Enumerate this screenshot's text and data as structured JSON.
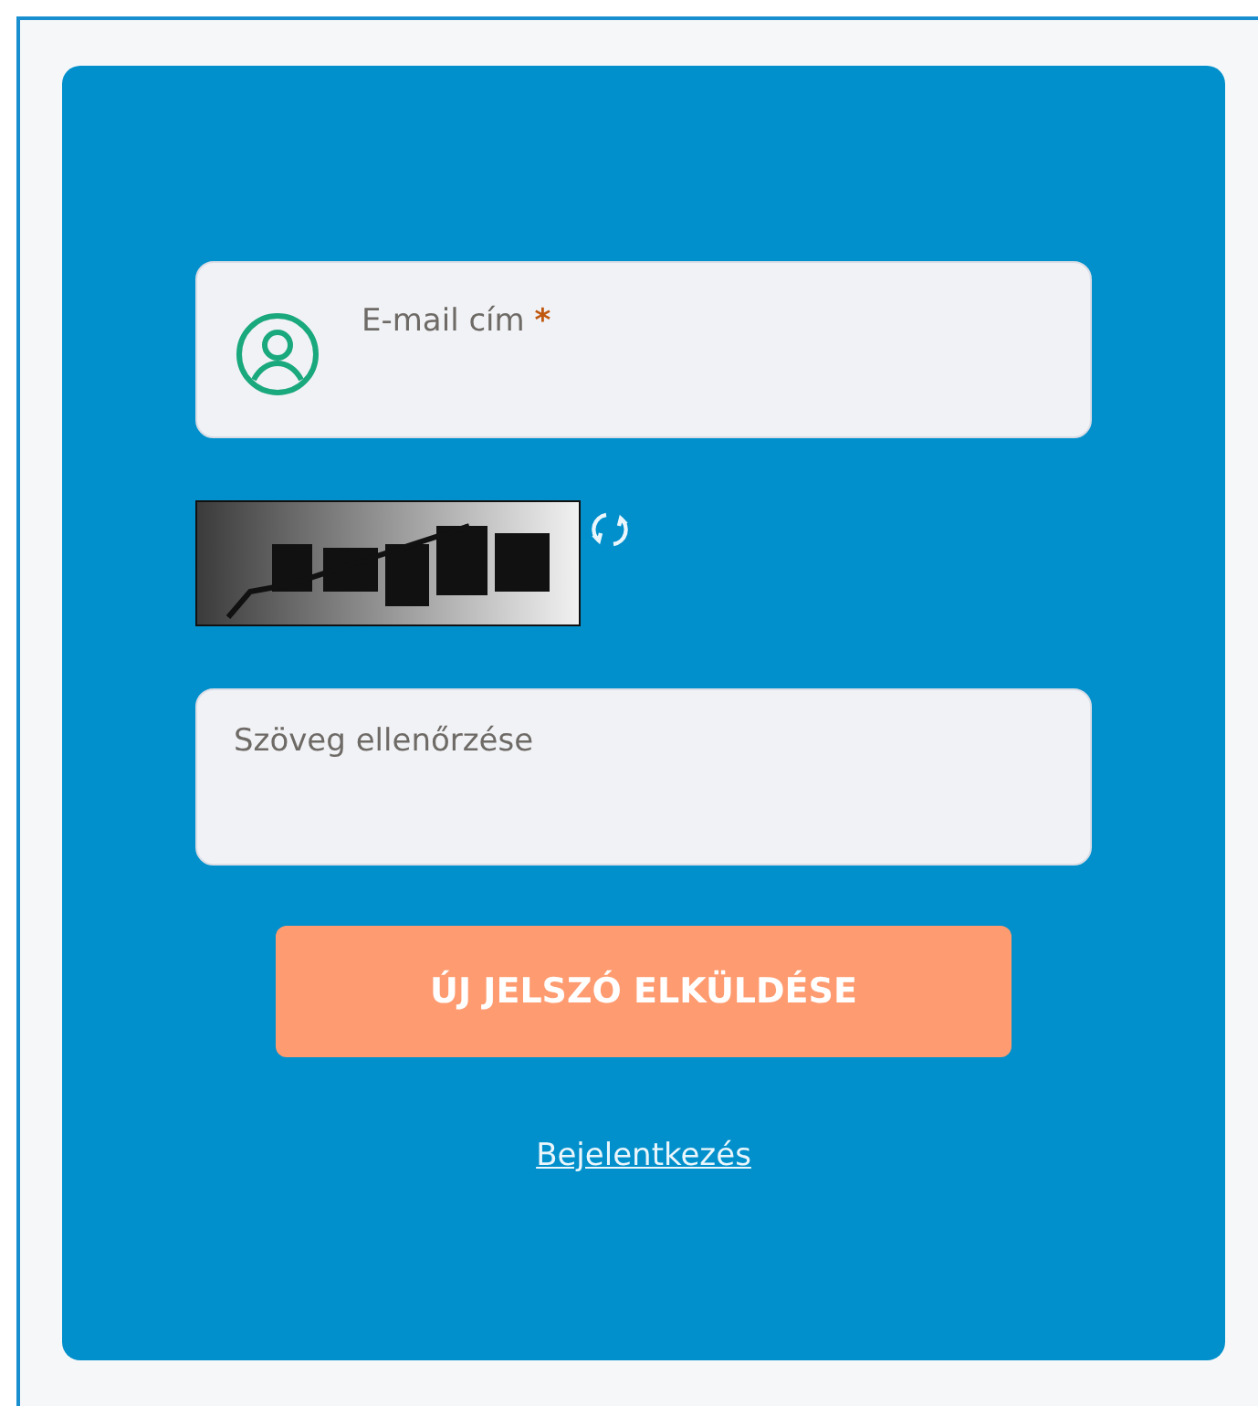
{
  "email_field": {
    "label": "E-mail cím",
    "required_mark": "*"
  },
  "verify_field": {
    "placeholder": "Szöveg ellenőrzése"
  },
  "submit_button": {
    "label": "ÚJ JELSZÓ ELKÜLDÉSE"
  },
  "login_link": {
    "label": "Bejelentkezés"
  }
}
